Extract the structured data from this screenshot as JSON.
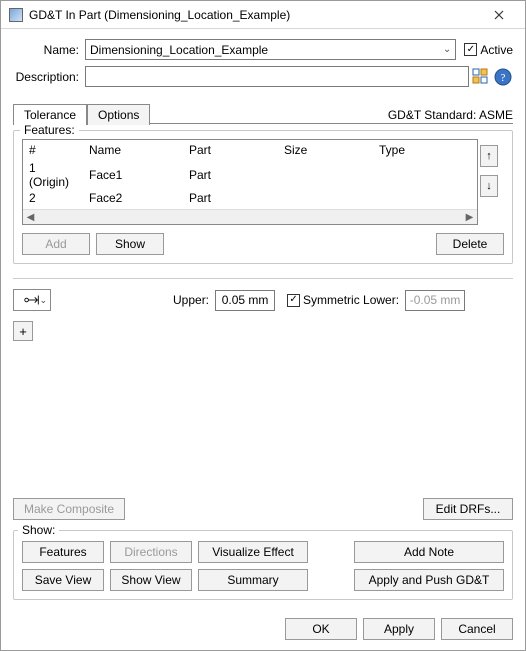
{
  "window": {
    "title": "GD&T In Part (Dimensioning_Location_Example)"
  },
  "fields": {
    "name_label": "Name:",
    "name_value": "Dimensioning_Location_Example",
    "active_label": "Active",
    "active_checked": "✓",
    "description_label": "Description:",
    "description_value": ""
  },
  "tabs": {
    "tolerance": "Tolerance",
    "options": "Options"
  },
  "standard": "GD&T Standard: ASME",
  "features": {
    "title": "Features:",
    "cols": {
      "num": "#",
      "name": "Name",
      "part": "Part",
      "size": "Size",
      "type": "Type"
    },
    "rows": [
      {
        "num": "1 (Origin)",
        "name": "Face1",
        "part": "Part",
        "size": "",
        "type": ""
      },
      {
        "num": "2",
        "name": "Face2",
        "part": "Part",
        "size": "",
        "type": ""
      }
    ],
    "add": "Add",
    "show": "Show",
    "delete": "Delete",
    "move_up": "↑",
    "move_down": "↓"
  },
  "tolerance": {
    "upper_label": "Upper:",
    "upper_value": "0.05 mm",
    "sym_label": "Symmetric Lower:",
    "sym_checked": "✓",
    "lower_value": "-0.05 mm",
    "plus": "+"
  },
  "actions": {
    "make_composite": "Make Composite",
    "edit_drfs": "Edit DRFs..."
  },
  "show": {
    "title": "Show:",
    "features": "Features",
    "directions": "Directions",
    "visualize": "Visualize Effect",
    "add_note": "Add Note",
    "save_view": "Save View",
    "show_view": "Show View",
    "summary": "Summary",
    "apply_push": "Apply and Push GD&T"
  },
  "footer": {
    "ok": "OK",
    "apply": "Apply",
    "cancel": "Cancel"
  }
}
